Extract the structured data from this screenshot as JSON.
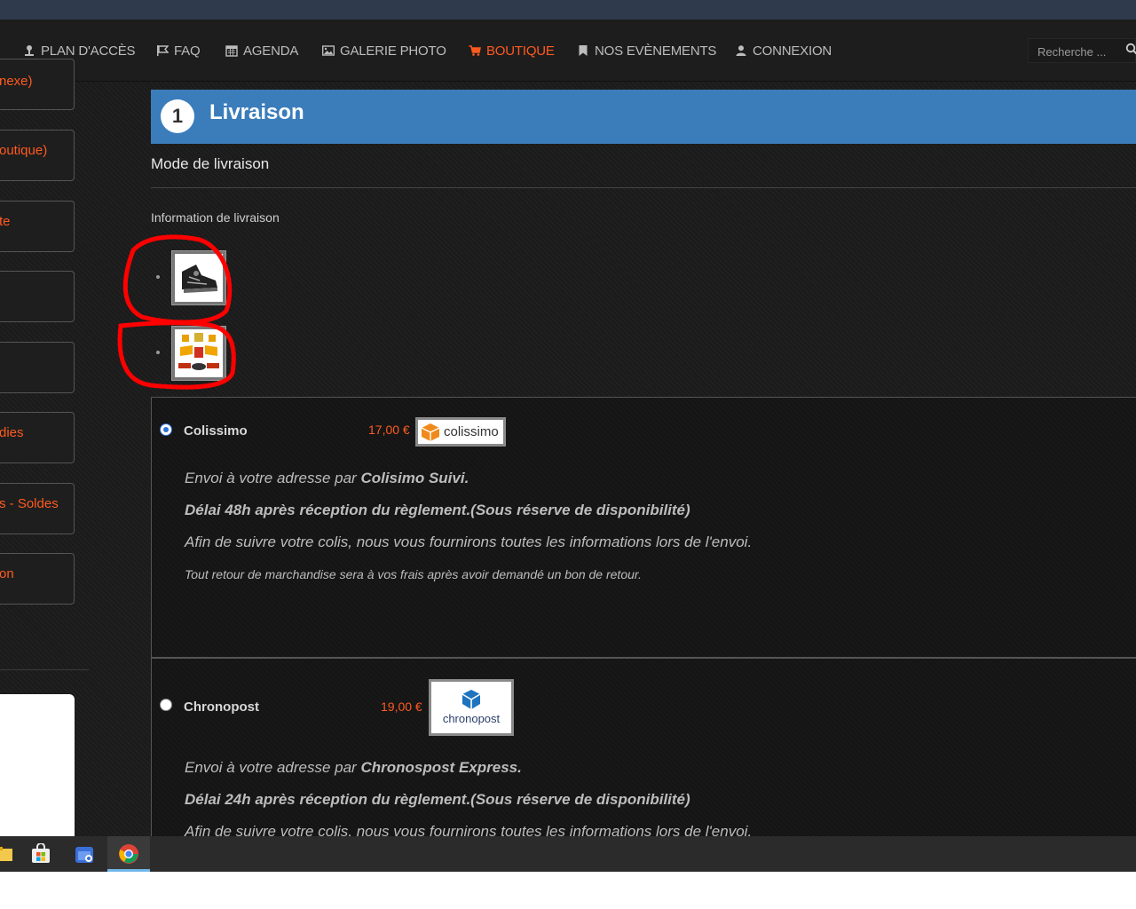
{
  "nav": {
    "items": [
      {
        "label": "PLAN D'ACCÈS",
        "icon": "map-pin-icon",
        "active": false
      },
      {
        "label": "FAQ",
        "icon": "flag-icon",
        "active": false
      },
      {
        "label": "AGENDA",
        "icon": "calendar-icon",
        "active": false
      },
      {
        "label": "GALERIE PHOTO",
        "icon": "picture-icon",
        "active": false
      },
      {
        "label": "BOUTIQUE",
        "icon": "cart-icon",
        "active": true
      },
      {
        "label": "NOS EVÈNEMENTS",
        "icon": "bookmark-icon",
        "active": false
      },
      {
        "label": "CONNEXION",
        "icon": "user-icon",
        "active": false
      }
    ],
    "search_placeholder": "Recherche ..."
  },
  "sidebar": {
    "items": [
      "nexe)",
      "outique)",
      "te",
      "",
      "",
      "dies",
      "s - Soldes",
      "on"
    ]
  },
  "step": {
    "number": "1",
    "title": "Livraison"
  },
  "shipping": {
    "mode_label": "Mode de livraison",
    "info_label": "Information de livraison",
    "cart_thumbnails": [
      "shoe-thumbnail",
      "kart-parts-thumbnail"
    ]
  },
  "carriers": [
    {
      "name": "Colissimo",
      "price": "17,00 €",
      "logo_text": "colissimo",
      "selected": true,
      "line1_pre": "Envoi à votre adresse par ",
      "line1_bold": "Colisimo Suivi.",
      "line2": "Délai 48h après réception du règlement.(Sous réserve de disponibilité)",
      "line3": "Afin de suivre votre colis, nous vous fournirons toutes les informations lors de l'envoi.",
      "line4": "Tout retour de marchandise sera à vos frais après avoir demandé un bon de retour."
    },
    {
      "name": "Chronopost",
      "price": "19,00 €",
      "logo_text": "chronopost",
      "selected": false,
      "line1_pre": "Envoi à votre adresse par ",
      "line1_bold": "Chronospost Express.",
      "line2": "Délai 24h après réception du règlement.(Sous réserve de disponibilité)",
      "line3": "Afin de suivre votre colis, nous vous fournirons toutes les informations lors de l'envoi."
    }
  ],
  "colors": {
    "accent": "#ff5a1f",
    "step_bar": "#3b7dbb",
    "annotation": "#ff0000"
  }
}
